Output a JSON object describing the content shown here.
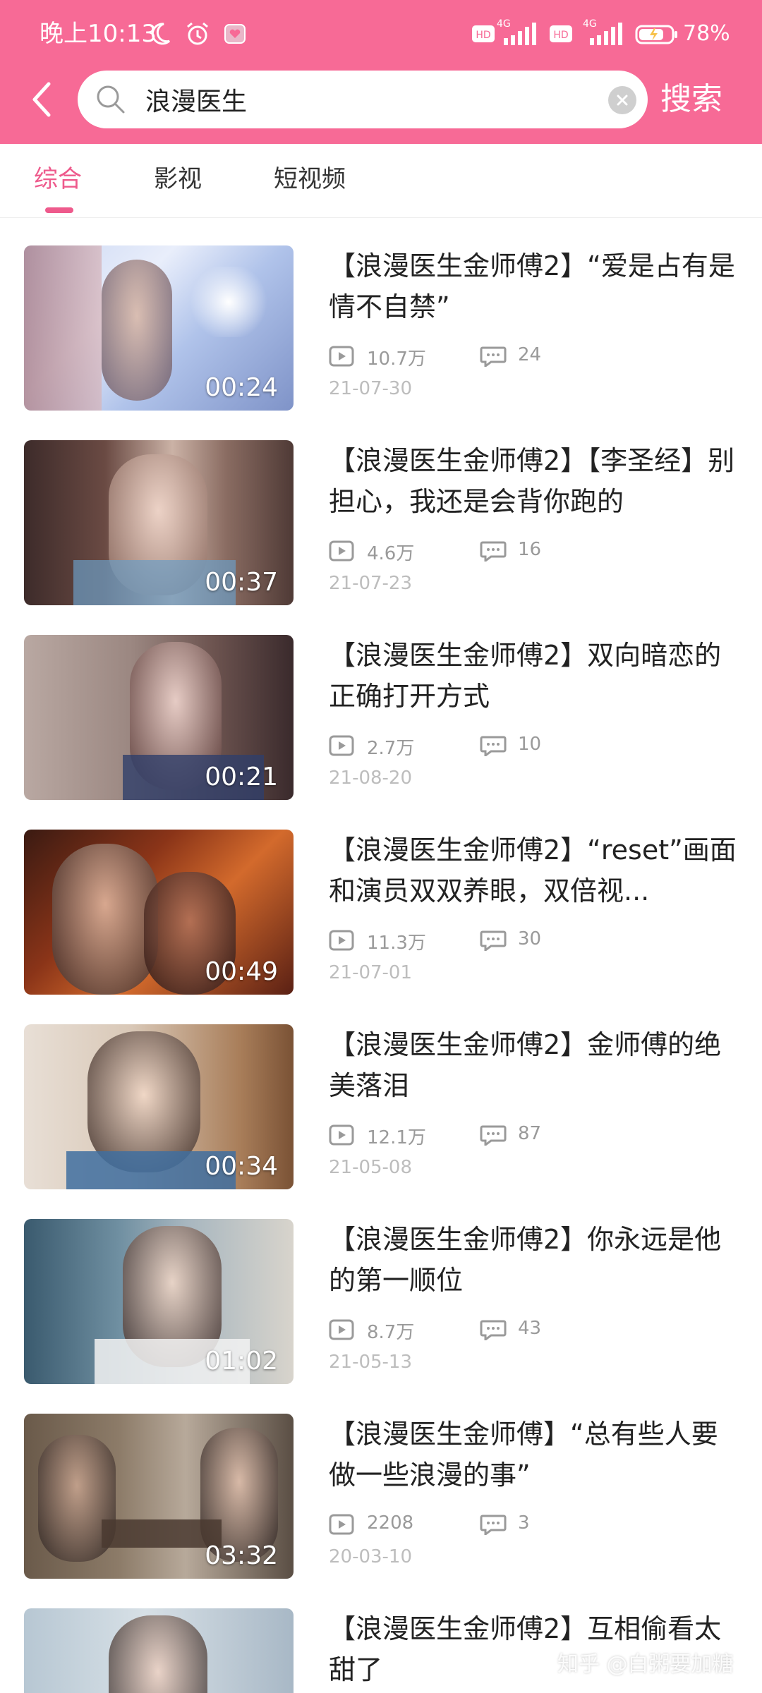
{
  "status_bar": {
    "time": "晚上10:13",
    "battery": "78%",
    "network1": "4G",
    "network2": "4G"
  },
  "search": {
    "query": "浪漫医生",
    "submit_label": "搜索"
  },
  "tabs": [
    {
      "label": "综合",
      "active": true
    },
    {
      "label": "影视",
      "active": false
    },
    {
      "label": "短视频",
      "active": false
    }
  ],
  "results": [
    {
      "title": "【浪漫医生金师傅2】“爱是占有是情不自禁”",
      "duration": "00:24",
      "views": "10.7万",
      "comments": "24",
      "date": "21-07-30"
    },
    {
      "title": "【浪漫医生金师傅2】【李圣经】别担心，我还是会背你跑的",
      "duration": "00:37",
      "views": "4.6万",
      "comments": "16",
      "date": "21-07-23"
    },
    {
      "title": "【浪漫医生金师傅2】双向暗恋的正确打开方式",
      "duration": "00:21",
      "views": "2.7万",
      "comments": "10",
      "date": "21-08-20"
    },
    {
      "title": "【浪漫医生金师傅2】“reset”画面和演员双双养眼，双倍视...",
      "duration": "00:49",
      "views": "11.3万",
      "comments": "30",
      "date": "21-07-01"
    },
    {
      "title": "【浪漫医生金师傅2】金师傅的绝美落泪",
      "duration": "00:34",
      "views": "12.1万",
      "comments": "87",
      "date": "21-05-08"
    },
    {
      "title": "【浪漫医生金师傅2】你永远是他的第一顺位",
      "duration": "01:02",
      "views": "8.7万",
      "comments": "43",
      "date": "21-05-13"
    },
    {
      "title": "【浪漫医生金师傅】“总有些人要做一些浪漫的事”",
      "duration": "03:32",
      "views": "2208",
      "comments": "3",
      "date": "20-03-10"
    },
    {
      "title": "【浪漫医生金师傅2】互相偷看太甜了",
      "duration": "",
      "views": "",
      "comments": "",
      "date": ""
    }
  ],
  "watermark": "知乎 @白粥要加糖",
  "colors": {
    "header_pink": "#F76A96",
    "tab_active": "#EE5A8C"
  }
}
